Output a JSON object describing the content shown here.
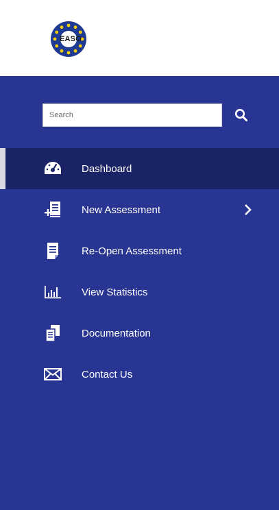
{
  "header": {
    "logo_text": "EASO",
    "logo_icon": "eu-stars-logo"
  },
  "search": {
    "placeholder": "Search",
    "value": "",
    "button_icon": "search-icon"
  },
  "menu": {
    "items": [
      {
        "label": "Dashboard",
        "icon": "dashboard-icon",
        "active": true
      },
      {
        "label": "New Assessment",
        "icon": "new-assessment-icon",
        "has_submenu": true
      },
      {
        "label": "Re-Open Assessment",
        "icon": "document-icon"
      },
      {
        "label": "View Statistics",
        "icon": "statistics-icon"
      },
      {
        "label": "Documentation",
        "icon": "documentation-icon"
      },
      {
        "label": "Contact Us",
        "icon": "envelope-icon"
      }
    ]
  },
  "colors": {
    "sidebar_bg": "#283593",
    "active_bg": "#1a2366",
    "text": "#ffffff",
    "logo_blue": "#1f3a93",
    "logo_star": "#f5d000"
  }
}
